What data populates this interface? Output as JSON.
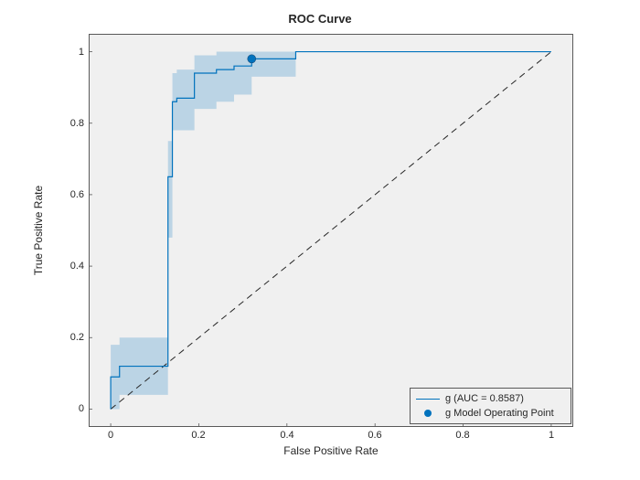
{
  "chart_data": {
    "type": "line",
    "title": "ROC Curve",
    "xlabel": "False Positive Rate",
    "ylabel": "True Positive Rate",
    "xlim": [
      -0.05,
      1.05
    ],
    "ylim": [
      -0.05,
      1.05
    ],
    "xticks": [
      0,
      0.2,
      0.4,
      0.6,
      0.8,
      1
    ],
    "yticks": [
      0,
      0.2,
      0.4,
      0.6,
      0.8,
      1
    ],
    "series": [
      {
        "name": "g_roc",
        "x": [
          0.0,
          0.0,
          0.02,
          0.02,
          0.13,
          0.13,
          0.14,
          0.14,
          0.15,
          0.15,
          0.19,
          0.19,
          0.24,
          0.24,
          0.28,
          0.28,
          0.32,
          0.32,
          0.42,
          0.42,
          1.0
        ],
        "y": [
          0.0,
          0.09,
          0.09,
          0.12,
          0.12,
          0.65,
          0.65,
          0.86,
          0.86,
          0.87,
          0.87,
          0.94,
          0.94,
          0.95,
          0.95,
          0.96,
          0.96,
          0.98,
          0.98,
          1.0,
          1.0
        ],
        "color": "#0072BD"
      },
      {
        "name": "diagonal",
        "x": [
          0,
          1
        ],
        "y": [
          0,
          1
        ],
        "style": "dashed",
        "color": "#262626"
      }
    ],
    "confidence_band": {
      "x": [
        0.0,
        0.0,
        0.02,
        0.02,
        0.13,
        0.13,
        0.14,
        0.14,
        0.15,
        0.15,
        0.19,
        0.19,
        0.24,
        0.24,
        0.28,
        0.28,
        0.32,
        0.32,
        0.42,
        0.42,
        1.0
      ],
      "hi": [
        0.07,
        0.18,
        0.18,
        0.2,
        0.2,
        0.75,
        0.75,
        0.94,
        0.94,
        0.95,
        0.95,
        0.99,
        0.99,
        1.0,
        1.0,
        1.0,
        1.0,
        1.0,
        1.0,
        1.0,
        1.0
      ],
      "lo": [
        0.0,
        0.0,
        0.0,
        0.04,
        0.04,
        0.48,
        0.48,
        0.78,
        0.78,
        0.78,
        0.78,
        0.84,
        0.84,
        0.86,
        0.86,
        0.88,
        0.88,
        0.93,
        0.93,
        1.0,
        1.0
      ],
      "color": "#0072BD",
      "opacity": 0.22
    },
    "operating_point": {
      "x": 0.32,
      "y": 0.98
    },
    "auc": 0.8587
  },
  "legend": {
    "line_label": "g (AUC = 0.8587)",
    "point_label": "g Model Operating Point"
  },
  "colors": {
    "axes_bg": "#f0f0f0",
    "axes_edge": "#595959",
    "series": "#0072BD"
  }
}
